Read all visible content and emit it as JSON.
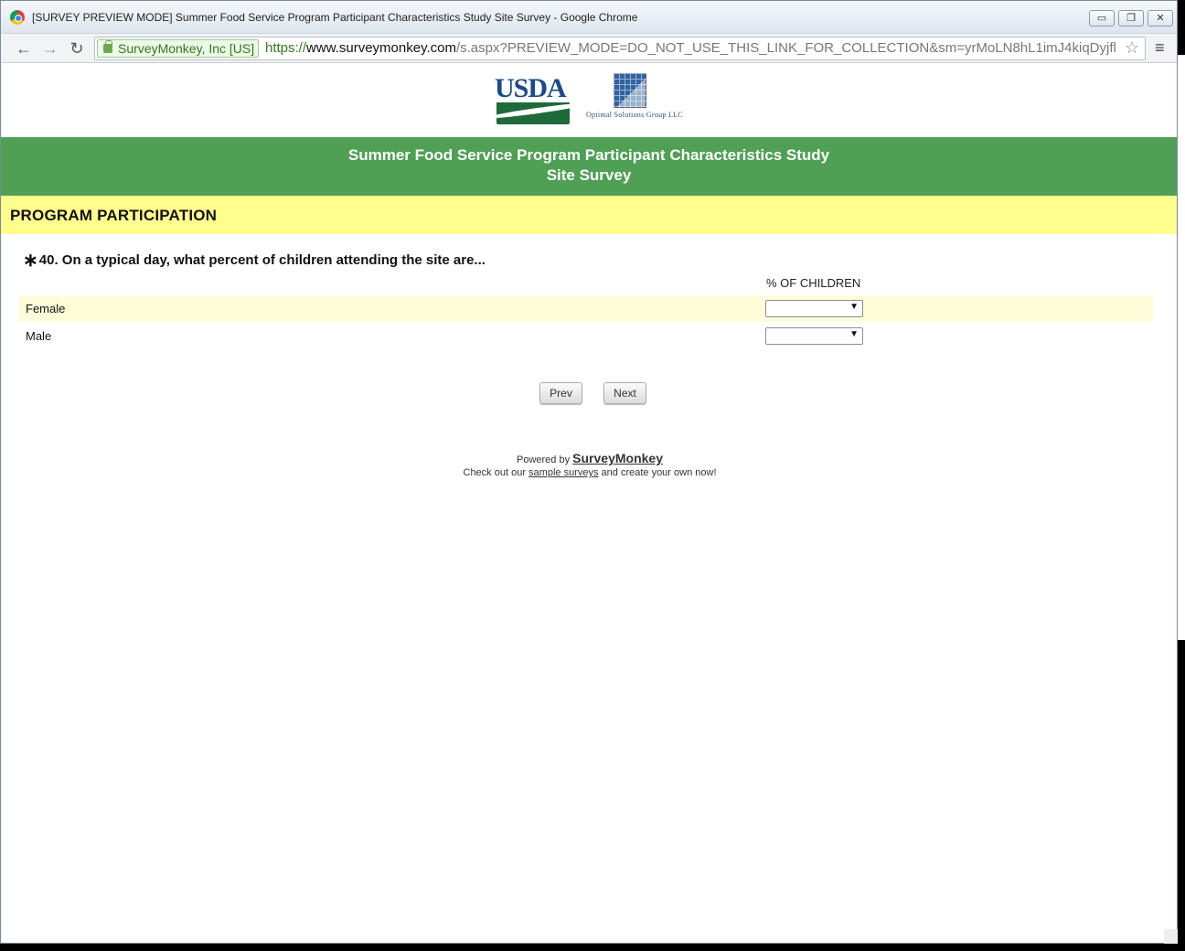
{
  "window": {
    "title": "[SURVEY PREVIEW MODE] Summer Food Service Program Participant Characteristics Study Site Survey - Google Chrome",
    "minimize": "▭",
    "restore": "❐",
    "close": "✕"
  },
  "toolbar": {
    "back": "←",
    "forward": "→",
    "reload": "↻",
    "ev_label": "SurveyMonkey, Inc [US]",
    "url_scheme": "https://",
    "url_host": "www.surveymonkey.com",
    "url_path": "/s.aspx?PREVIEW_MODE=DO_NOT_USE_THIS_LINK_FOR_COLLECTION&sm=yrMoLN8hL1imJ4kiqDyjfl",
    "star": "☆",
    "menu": "≡"
  },
  "logos": {
    "usda_text": "USDA",
    "osg_text": "Optimal Solutions Group LLC"
  },
  "header": {
    "line1": "Summer Food Service Program Participant Characteristics Study",
    "line2": "Site Survey"
  },
  "section": {
    "title": "PROGRAM PARTICIPATION"
  },
  "question": {
    "required_mark": "∗",
    "text": "40. On a typical day, what percent of children attending the site are...",
    "column_header": "% OF CHILDREN",
    "rows": [
      {
        "label": "Female",
        "value": "",
        "arrow": "▼"
      },
      {
        "label": "Male",
        "value": "",
        "arrow": "▼"
      }
    ]
  },
  "nav": {
    "prev": "Prev",
    "next": "Next"
  },
  "footer": {
    "powered_by": "Powered by",
    "brand": "SurveyMonkey",
    "checkout_prefix": "Check out our",
    "sample_link": "sample surveys",
    "checkout_suffix": "and create your own now!"
  }
}
